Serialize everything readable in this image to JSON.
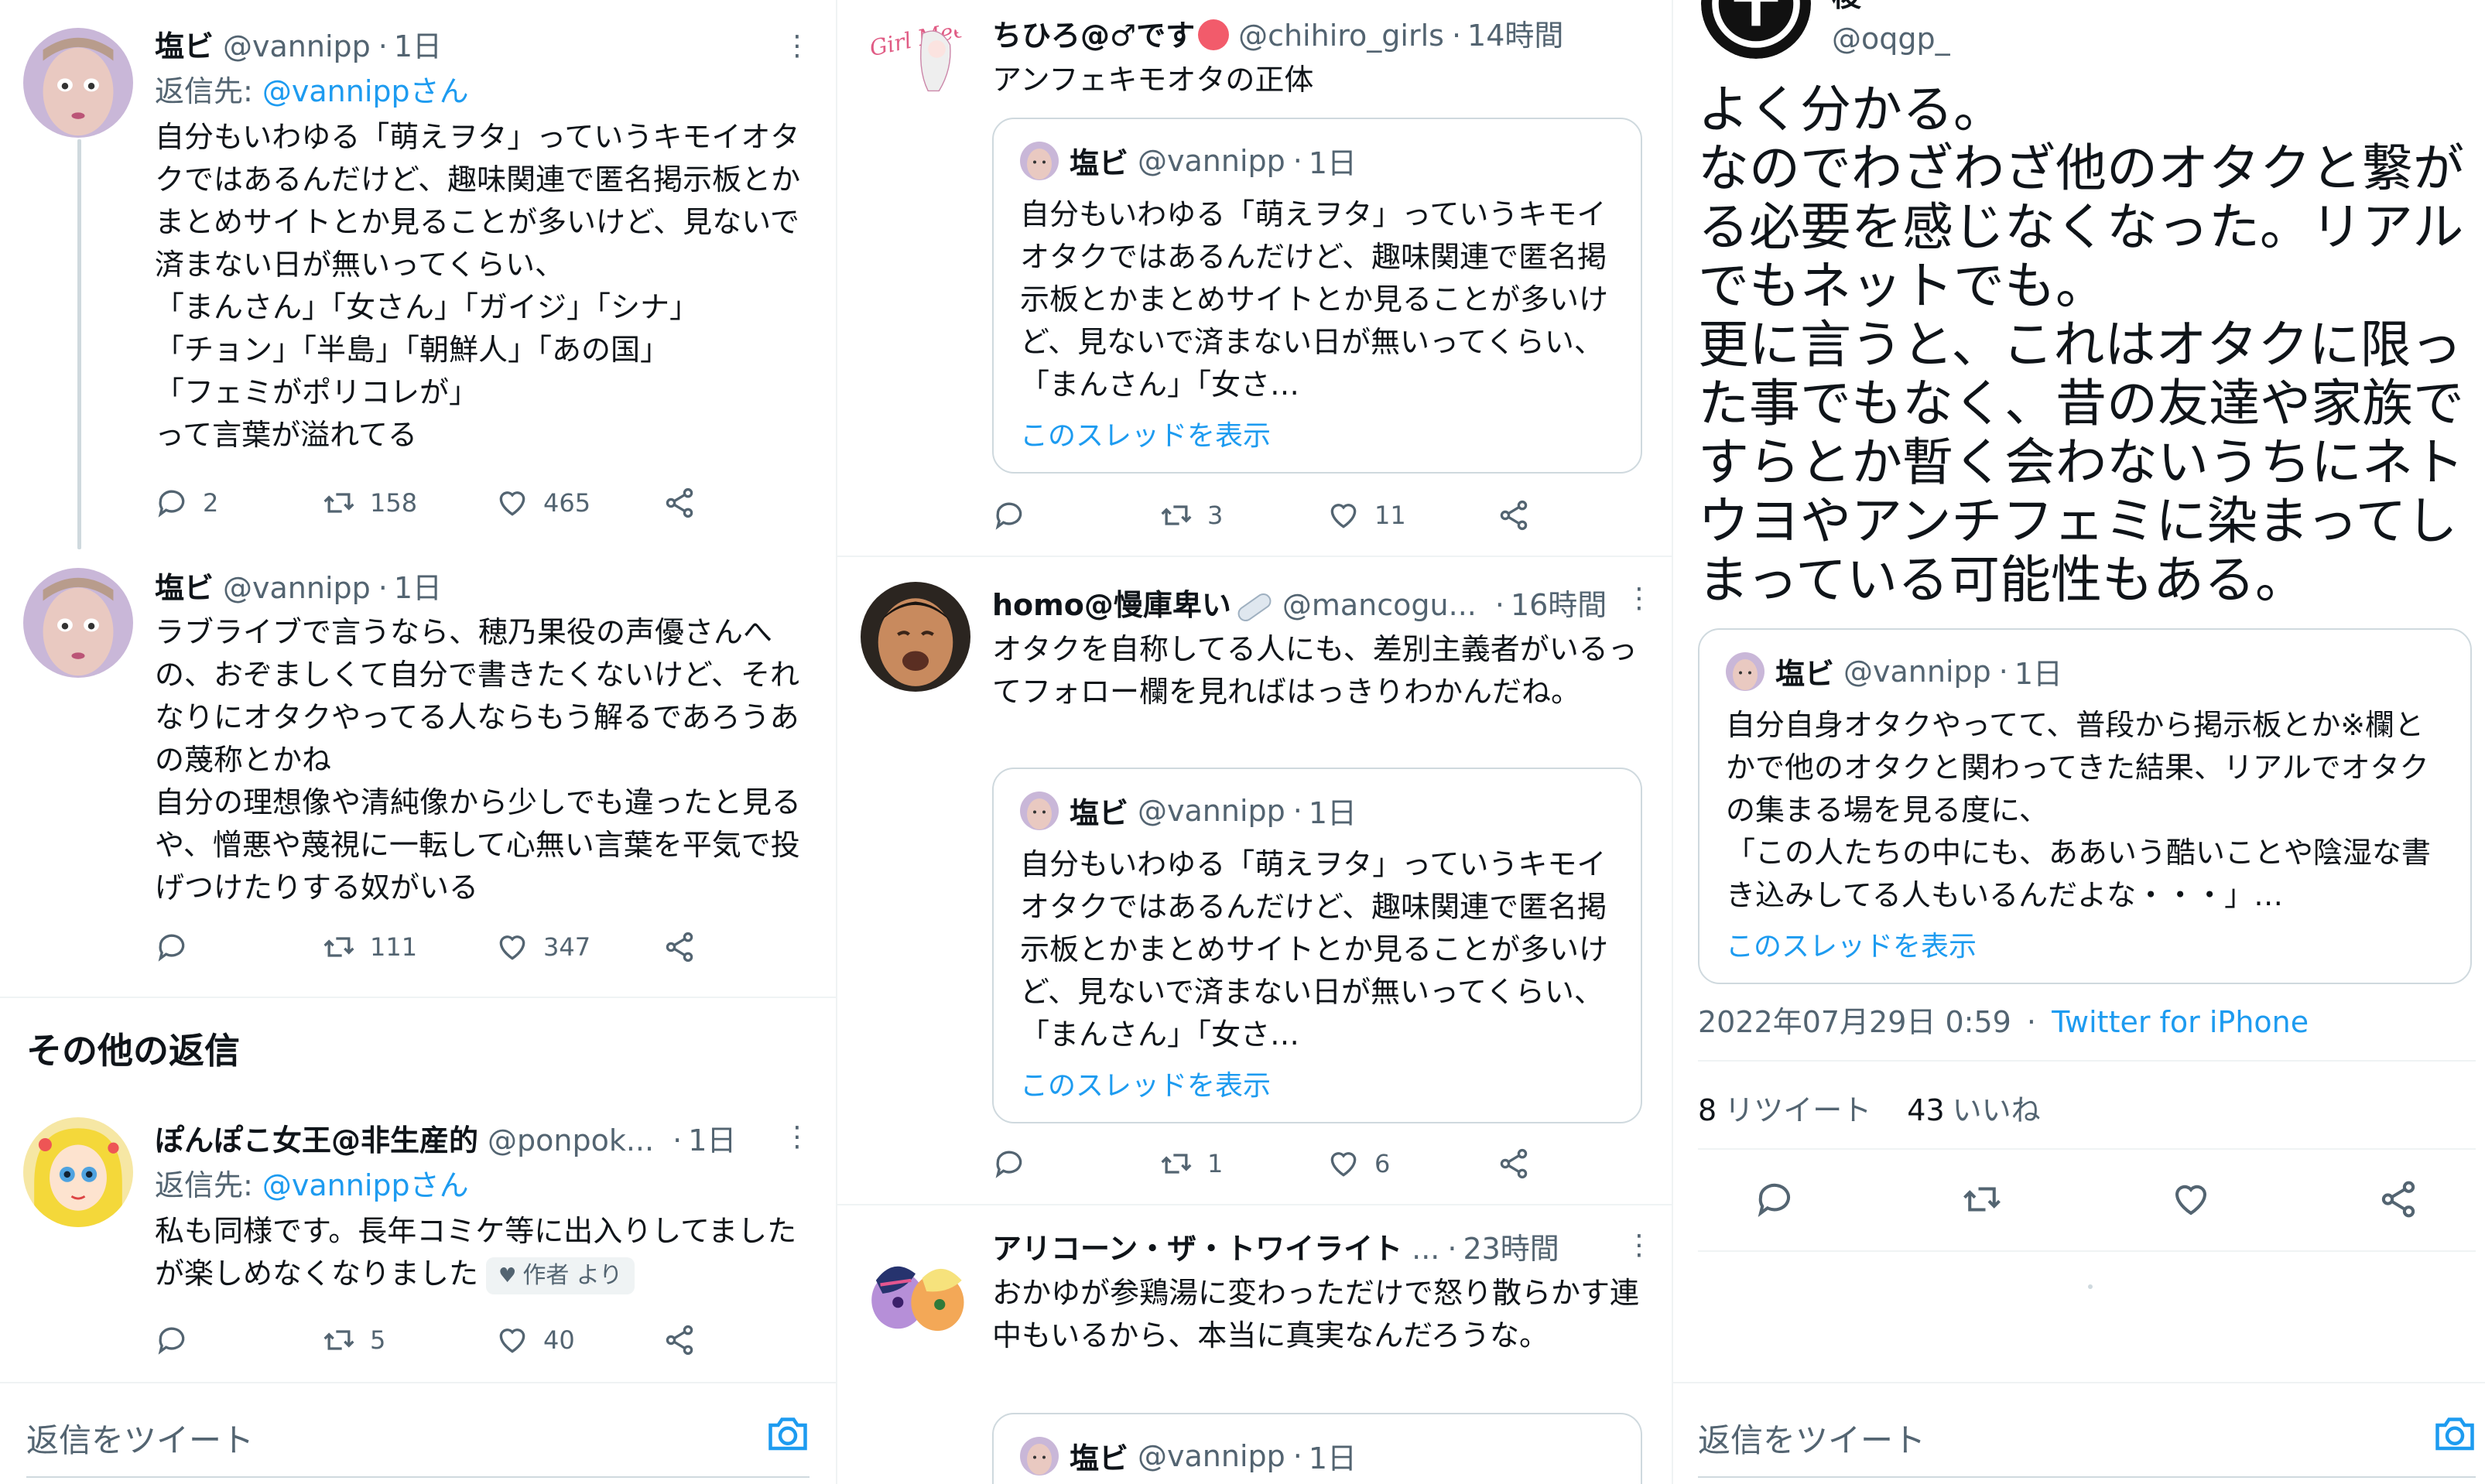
{
  "colors": {
    "accent": "#1d9bf0",
    "text": "#0f1419",
    "secondary": "#536471",
    "border": "#cfd9de",
    "divider": "#eff3f4"
  },
  "left": {
    "tweets": [
      {
        "name": "塩ビ",
        "handle": "@vannipp",
        "dot": "·",
        "time": "1日",
        "reply_prefix": "返信先: ",
        "reply_mention": "@vannippさん",
        "text": "自分もいわゆる「萌えヲタ」っていうキモイオタクではあるんだけど、趣味関連で匿名掲示板とかまとめサイトとか見ることが多いけど、見ないで済まない日が無いってくらい、\n「まんさん」「女さん」「ガイジ」「シナ」\n「チョン」「半島」「朝鮮人」「あの国」\n「フェミがポリコレが」\nって言葉が溢れてる",
        "replies": "2",
        "retweets": "158",
        "likes": "465"
      },
      {
        "name": "塩ビ",
        "handle": "@vannipp",
        "dot": "·",
        "time": "1日",
        "text": "ラブライブで言うなら、穂乃果役の声優さんへの、おぞましくて自分で書きたくないけど、それなりにオタクやってる人ならもう解るであろうあの蔑称とかね\n自分の理想像や清純像から少しでも違ったと見るや、憎悪や蔑視に一転して心無い言葉を平気で投げつけたりする奴がいる",
        "replies": "",
        "retweets": "111",
        "likes": "347"
      }
    ],
    "section_title": "その他の返信",
    "other_reply": {
      "name": "ぽんぽこ女王@非生産的",
      "handle": "@ponpok...",
      "dot": "·",
      "time": "1日",
      "reply_prefix": "返信先: ",
      "reply_mention": "@vannippさん",
      "text": "私も同様です。長年コミケ等に出入りしてましたが楽しめなくなりました",
      "author_badge": "作者 より",
      "replies": "",
      "retweets": "5",
      "likes": "40"
    },
    "compose_placeholder": "返信をツイート"
  },
  "middle": {
    "tweets": [
      {
        "name": "ちひろ@♂です",
        "handle": "@chihiro_girls",
        "dot": "·",
        "time": "14時間",
        "text": "アンフェキモオタの正体",
        "quote": {
          "name": "塩ビ",
          "handle": "@vannipp",
          "dot": "·",
          "time": "1日",
          "text": "自分もいわゆる「萌えヲタ」っていうキモイオタクではあるんだけど、趣味関連で匿名掲示板とかまとめサイトとか見ることが多いけど、見ないで済まない日が無いってくらい、「まんさん」「女さ…",
          "link": "このスレッドを表示"
        },
        "replies": "",
        "retweets": "3",
        "likes": "11"
      },
      {
        "name": "homo@慢庫卑い",
        "handle": "@mancogu...",
        "dot": "·",
        "time": "16時間",
        "text": "オタクを自称してる人にも、差別主義者がいるってフォロー欄を見ればはっきりわかんだね。",
        "quote": {
          "name": "塩ビ",
          "handle": "@vannipp",
          "dot": "·",
          "time": "1日",
          "text": "自分もいわゆる「萌えヲタ」っていうキモイオタクではあるんだけど、趣味関連で匿名掲示板とかまとめサイトとか見ることが多いけど、見ないで済まない日が無いってくらい、「まんさん」「女さ…",
          "link": "このスレッドを表示"
        },
        "replies": "",
        "retweets": "1",
        "likes": "6"
      },
      {
        "name": "アリコーン・ザ・トワイライト",
        "name_suffix": "...",
        "dot": "·",
        "time": "23時間",
        "text": "おかゆが参鶏湯に変わっただけで怒り散らかす連中もいるから、本当に真実なんだろうな。",
        "quote": {
          "name": "塩ビ",
          "handle": "@vannipp",
          "dot": "·",
          "time": "1日"
        }
      }
    ],
    "avatar_text": "Girl Meets Girl"
  },
  "right": {
    "name": "梭",
    "handle": "@oqgp_",
    "text": "よく分かる。\nなのでわざわざ他のオタクと繋がる必要を感じなくなった。リアルでもネットでも。\n更に言うと、これはオタクに限った事でもなく、昔の友達や家族ですらとか暫く会わないうちにネトウヨやアンチフェミに染まってしまっている可能性もある。",
    "quote": {
      "name": "塩ビ",
      "handle": "@vannipp",
      "dot": "·",
      "time": "1日",
      "text": "自分自身オタクやってて、普段から掲示板とか※欄とかで他のオタクと関わってきた結果、リアルでオタクの集まる場を見る度に、\n「この人たちの中にも、ああいう酷いことや陰湿な書き込みしてる人もいるんだよな・・・」…",
      "link": "このスレッドを表示"
    },
    "timestamp": "2022年07月29日 0:59",
    "meta_dot": "·",
    "via": "Twitter for iPhone",
    "retweet_count": "8",
    "retweet_label": "リツイート",
    "like_count": "43",
    "like_label": "いいね",
    "compose_placeholder": "返信をツイート"
  }
}
